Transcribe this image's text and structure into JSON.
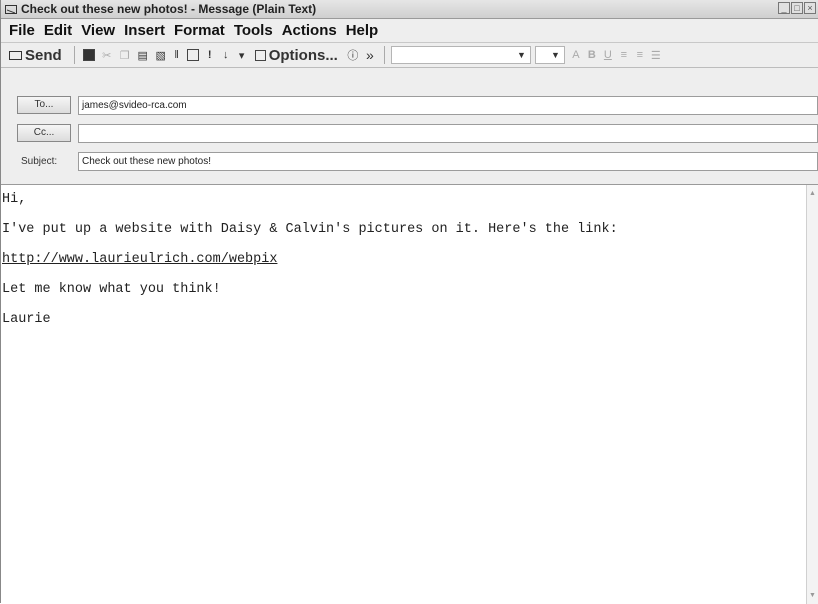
{
  "window": {
    "title": "Check out these new photos! - Message (Plain Text)",
    "title_icon": "envelope-icon"
  },
  "menu": [
    "File",
    "Edit",
    "View",
    "Insert",
    "Format",
    "Tools",
    "Actions",
    "Help"
  ],
  "toolbar": {
    "send_label": "Send",
    "options_label": "Options...",
    "overflow": "»"
  },
  "header": {
    "to_button": "To...",
    "to_value": "james@svideo-rca.com",
    "cc_button": "Cc...",
    "cc_value": "",
    "subject_label": "Subject:",
    "subject_value": "Check out these new photos!"
  },
  "body": {
    "greeting": "Hi,",
    "line1": "I've put up a website with Daisy & Calvin's pictures on it. Here's the link:",
    "link": "http://www.laurieulrich.com/webpix",
    "line2": "Let me know what you think!",
    "signature": "Laurie"
  }
}
